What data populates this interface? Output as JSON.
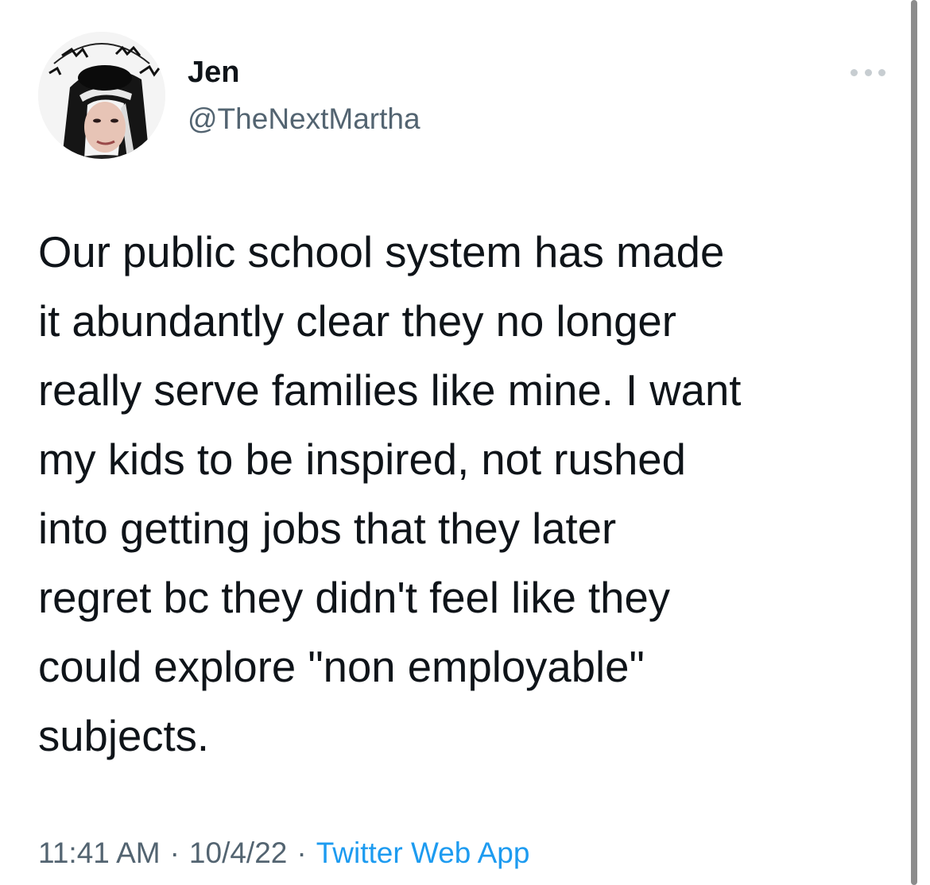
{
  "author": {
    "display_name": "Jen",
    "handle": "@TheNextMartha",
    "avatar_icon": "profile-photo"
  },
  "more_icon": "more-options-icon",
  "tweet": {
    "text": "Our public school system has made\nit abundantly clear they no longer\nreally serve families like mine. I want\nmy kids to be inspired, not rushed\ninto getting jobs that they later\nregret bc they didn't feel like they\ncould explore \"non employable\"\nsubjects."
  },
  "meta": {
    "time": "11:41 AM",
    "separator": "·",
    "date": "10/4/22",
    "source": "Twitter Web App"
  },
  "colors": {
    "text_primary": "#0f1419",
    "text_secondary": "#536471",
    "link": "#1d9bf0",
    "background": "#ffffff"
  }
}
